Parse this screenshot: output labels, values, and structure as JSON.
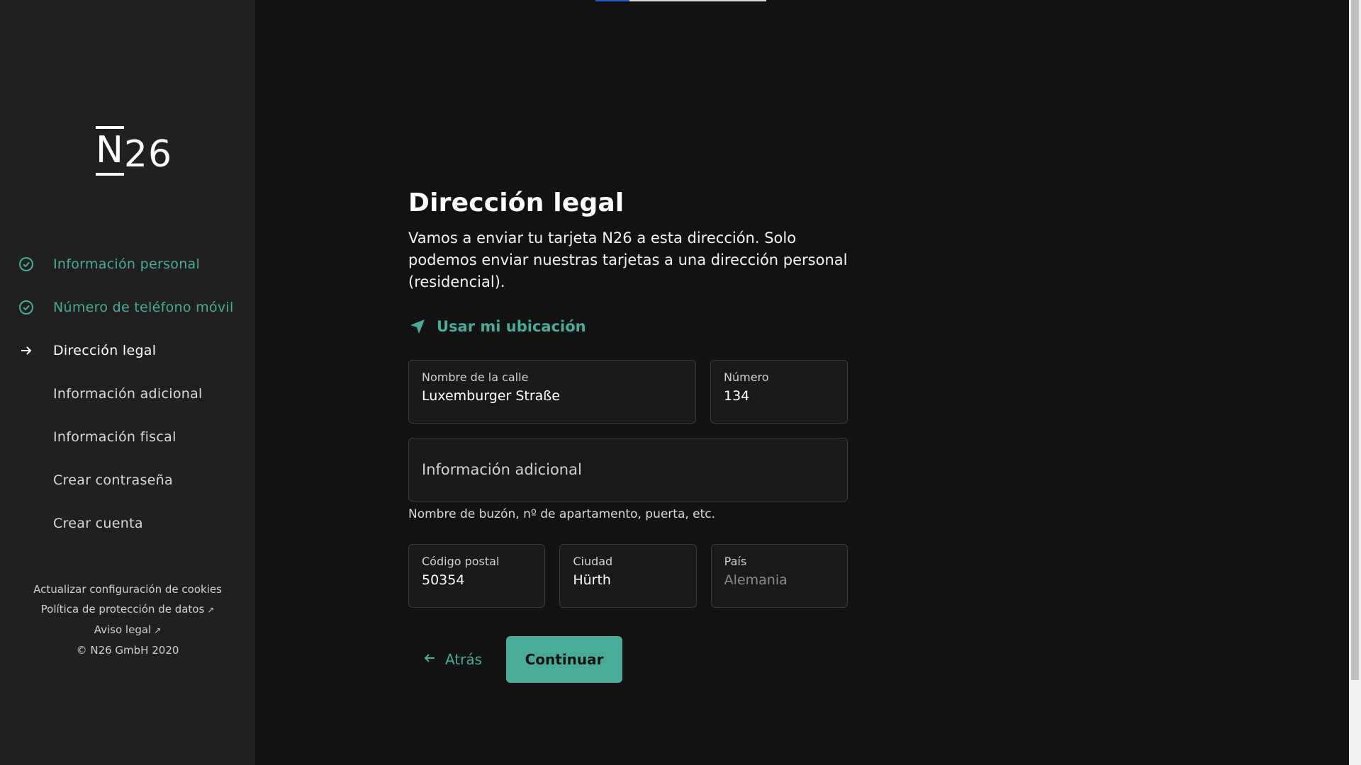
{
  "brand": {
    "logo_n": "N",
    "logo_rest": "26"
  },
  "steps": [
    {
      "label": "Información personal",
      "state": "done",
      "icon": "check-circle-icon"
    },
    {
      "label": "Número de teléfono móvil",
      "state": "done",
      "icon": "check-circle-icon"
    },
    {
      "label": "Dirección legal",
      "state": "current",
      "icon": "arrow-right-icon"
    },
    {
      "label": "Información adicional",
      "state": "todo"
    },
    {
      "label": "Información fiscal",
      "state": "todo"
    },
    {
      "label": "Crear contraseña",
      "state": "todo"
    },
    {
      "label": "Crear cuenta",
      "state": "todo"
    }
  ],
  "footer": {
    "cookies": "Actualizar configuración de cookies",
    "privacy": "Política de protección de datos",
    "legal": "Aviso legal",
    "copyright": "© N26 GmbH 2020",
    "external_icon": "↗"
  },
  "progress": {
    "fraction": 0.2
  },
  "page": {
    "title": "Dirección legal",
    "description": "Vamos a enviar tu tarjeta N26 a esta dirección. Solo podemos enviar nuestras tarjetas a una dirección personal (residencial).",
    "use_location": "Usar mi ubicación"
  },
  "form": {
    "street": {
      "label": "Nombre de la calle",
      "value": "Luxemburger Straße"
    },
    "number": {
      "label": "Número",
      "value": "134"
    },
    "additional": {
      "placeholder": "Información adicional",
      "hint": "Nombre de buzón, nº de apartamento, puerta, etc."
    },
    "postal": {
      "label": "Código postal",
      "value": "50354"
    },
    "city": {
      "label": "Ciudad",
      "value": "Hürth"
    },
    "country": {
      "label": "País",
      "value": "Alemania"
    }
  },
  "actions": {
    "back": "Atrás",
    "continue": "Continuar"
  },
  "colors": {
    "accent": "#48ac98",
    "background": "#121212",
    "sidebar": "#202020"
  }
}
